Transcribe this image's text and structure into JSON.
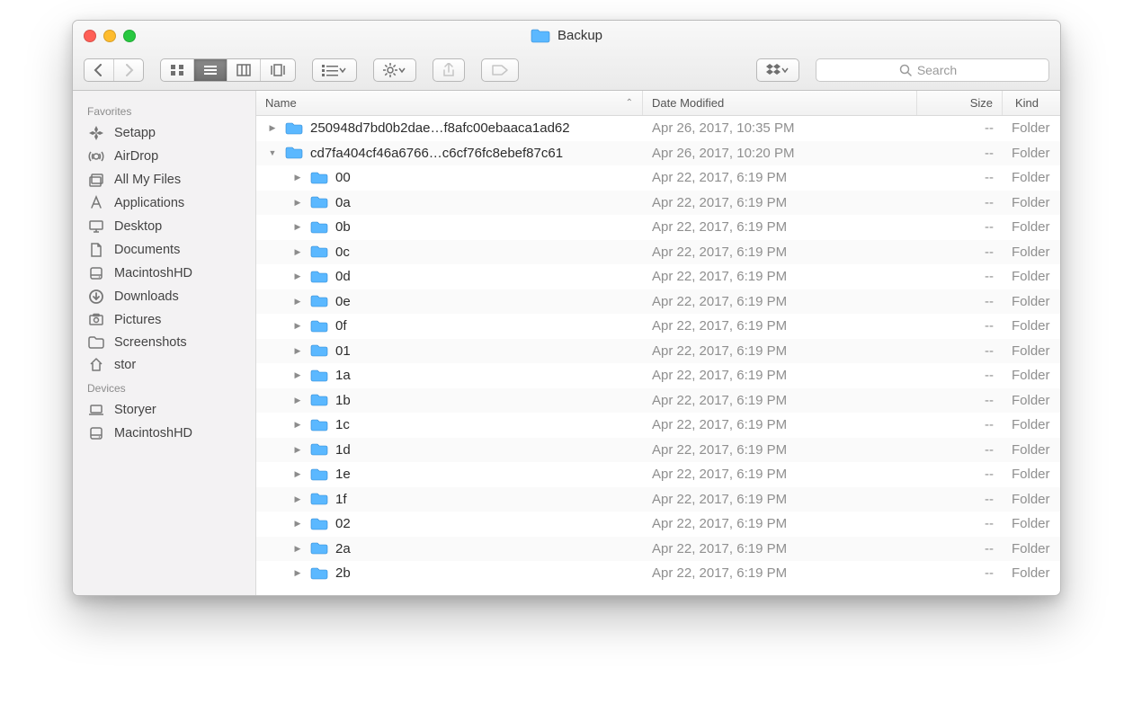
{
  "window": {
    "title": "Backup"
  },
  "toolbar": {
    "traffic": {
      "close": "close",
      "minimize": "minimize",
      "maximize": "maximize"
    },
    "search_placeholder": "Search"
  },
  "sidebar": {
    "sections": [
      {
        "title": "Favorites",
        "items": [
          {
            "icon": "setapp",
            "label": "Setapp"
          },
          {
            "icon": "airdrop",
            "label": "AirDrop"
          },
          {
            "icon": "all-files",
            "label": "All My Files"
          },
          {
            "icon": "applications",
            "label": "Applications"
          },
          {
            "icon": "desktop",
            "label": "Desktop"
          },
          {
            "icon": "documents",
            "label": "Documents"
          },
          {
            "icon": "disk",
            "label": "MacintoshHD"
          },
          {
            "icon": "downloads",
            "label": "Downloads"
          },
          {
            "icon": "pictures",
            "label": "Pictures"
          },
          {
            "icon": "folder",
            "label": "Screenshots"
          },
          {
            "icon": "home",
            "label": "stor"
          }
        ]
      },
      {
        "title": "Devices",
        "items": [
          {
            "icon": "laptop",
            "label": "Storyer"
          },
          {
            "icon": "disk",
            "label": "MacintoshHD"
          }
        ]
      }
    ]
  },
  "columns": {
    "name": "Name",
    "date": "Date Modified",
    "size": "Size",
    "kind": "Kind"
  },
  "defaults": {
    "size": "--",
    "kind": "Folder",
    "sub_date": "Apr 22, 2017, 6:19 PM",
    "triangle_right": "▶",
    "triangle_down": "▼"
  },
  "files": [
    {
      "name": "250948d7bd0b2dae…f8afc00ebaaca1ad62",
      "date": "Apr 26, 2017, 10:35 PM",
      "indent": 0,
      "expanded": false
    },
    {
      "name": "cd7fa404cf46a6766…c6cf76fc8ebef87c61",
      "date": "Apr 26, 2017, 10:20 PM",
      "indent": 0,
      "expanded": true
    },
    {
      "name": "00",
      "indent": 1
    },
    {
      "name": "0a",
      "indent": 1
    },
    {
      "name": "0b",
      "indent": 1
    },
    {
      "name": "0c",
      "indent": 1
    },
    {
      "name": "0d",
      "indent": 1
    },
    {
      "name": "0e",
      "indent": 1
    },
    {
      "name": "0f",
      "indent": 1
    },
    {
      "name": "01",
      "indent": 1
    },
    {
      "name": "1a",
      "indent": 1
    },
    {
      "name": "1b",
      "indent": 1
    },
    {
      "name": "1c",
      "indent": 1
    },
    {
      "name": "1d",
      "indent": 1
    },
    {
      "name": "1e",
      "indent": 1
    },
    {
      "name": "1f",
      "indent": 1
    },
    {
      "name": "02",
      "indent": 1
    },
    {
      "name": "2a",
      "indent": 1
    },
    {
      "name": "2b",
      "indent": 1
    }
  ]
}
